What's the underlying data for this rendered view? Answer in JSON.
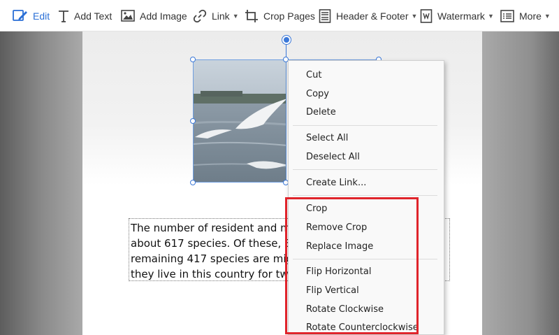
{
  "toolbar": {
    "items": [
      {
        "label": "Edit",
        "icon": "edit-icon",
        "active": true
      },
      {
        "label": "Add Text",
        "icon": "text-icon"
      },
      {
        "label": "Add Image",
        "icon": "image-icon"
      },
      {
        "label": "Link",
        "icon": "link-icon",
        "dropdown": true
      },
      {
        "label": "Crop Pages",
        "icon": "crop-pages-icon"
      },
      {
        "label": "Header & Footer",
        "icon": "header-footer-icon",
        "dropdown": true
      },
      {
        "label": "Watermark",
        "icon": "watermark-icon",
        "dropdown": true
      },
      {
        "label": "More",
        "icon": "more-icon",
        "dropdown": true
      }
    ],
    "accent_color": "#2a6fd6"
  },
  "document": {
    "text_lines": [
      "The number of resident and migr",
      "about 617 species. Of these, 300",
      "remaining 417 species are migrat",
      "they live in this country for twelv"
    ]
  },
  "context_menu": {
    "groups": [
      [
        "Cut",
        "Copy",
        "Delete"
      ],
      [
        "Select All",
        "Deselect All"
      ],
      [
        "Create Link..."
      ],
      [
        "Crop",
        "Remove Crop",
        "Replace Image"
      ],
      [
        "Flip Horizontal",
        "Flip Vertical",
        "Rotate Clockwise",
        "Rotate Counterclockwise"
      ]
    ],
    "highlight_color": "#e0242b"
  }
}
